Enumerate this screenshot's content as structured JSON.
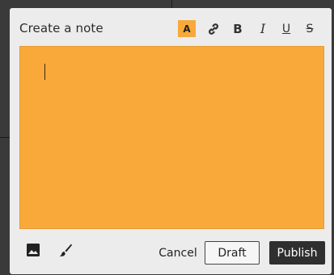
{
  "dialog": {
    "title": "Create a note"
  },
  "toolbar": {
    "accent_label": "A",
    "bold_label": "B",
    "italic_label": "I",
    "underline_label": "U",
    "strike_label": "S",
    "icons": [
      "text-color-icon",
      "link-icon",
      "bold-icon",
      "italic-icon",
      "underline-icon",
      "strikethrough-icon"
    ]
  },
  "editor": {
    "value": "",
    "background_color": "#f9a93a"
  },
  "footer": {
    "icons": [
      "image-icon",
      "brush-icon"
    ],
    "cancel_label": "Cancel",
    "draft_label": "Draft",
    "publish_label": "Publish"
  },
  "colors": {
    "accent": "#f8a93a",
    "publish_bg": "#2f2f2f"
  }
}
